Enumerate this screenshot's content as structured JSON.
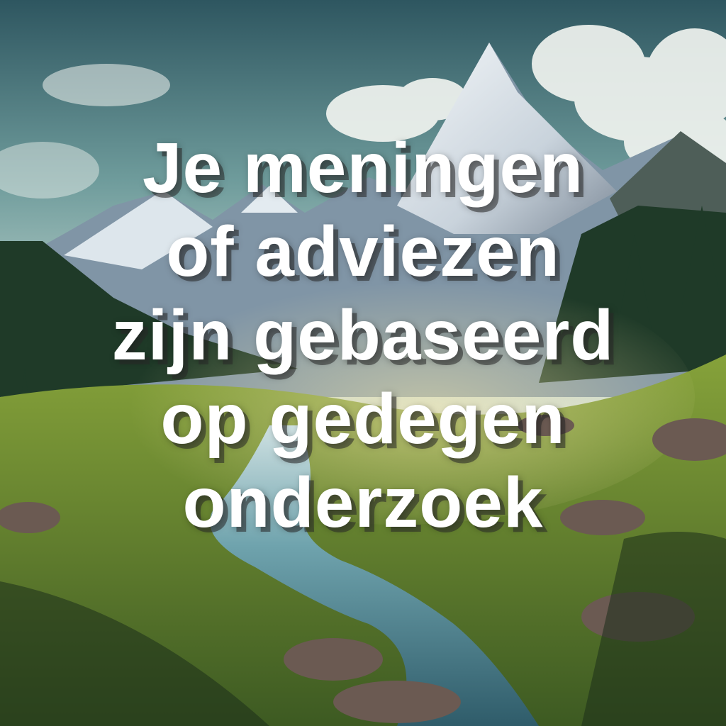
{
  "quote": {
    "lines": [
      "Je meningen",
      "of adviezen",
      "zijn gebaseerd",
      "op gedegen",
      "onderzoek"
    ]
  },
  "scene": {
    "description_icons": [
      "mountain-icon",
      "tree-icon",
      "river-icon",
      "cloud-icon"
    ],
    "colors": {
      "sky_top": "#2f5a63",
      "sky_mid": "#a9c7c4",
      "mountain_snow": "#e8eef2",
      "mountain_shadow": "#5a6a78",
      "forest": "#1f3a26",
      "meadow": "#6d8a2a",
      "river": "#5f93a0",
      "rock": "#6b5a52",
      "text": "#ffffff"
    }
  }
}
